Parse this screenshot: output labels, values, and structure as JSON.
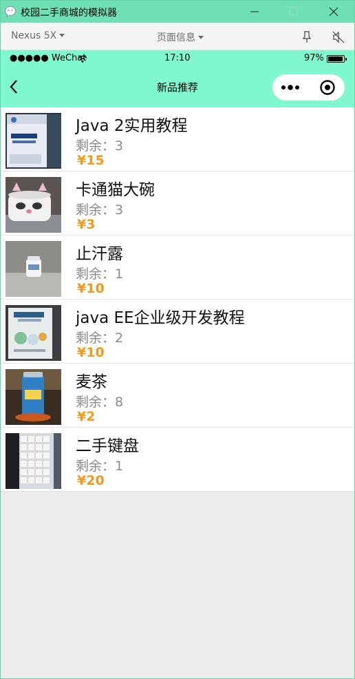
{
  "window": {
    "title": "校园二手商城的模拟器"
  },
  "toolbar": {
    "device": "Nexus 5X",
    "page_info": "页面信息"
  },
  "status_bar": {
    "carrier": "●●●●● WeChat",
    "time": "17:10",
    "battery": "97%",
    "battery_level": 0.97
  },
  "nav": {
    "title": "新品推荐"
  },
  "stock_prefix": "剩余：",
  "currency": "¥",
  "products": [
    {
      "name": "Java 2实用教程",
      "stock": "剩余：3",
      "price": "¥15",
      "image": "book-cover-java2"
    },
    {
      "name": "卡通猫大碗",
      "stock": "剩余：3",
      "price": "¥3",
      "image": "cat-bowl"
    },
    {
      "name": "止汗露",
      "stock": "剩余：1",
      "price": "¥10",
      "image": "antiperspirant-bottle"
    },
    {
      "name": "java EE企业级开发教程",
      "stock": "剩余：2",
      "price": "¥10",
      "image": "book-cover-javaee"
    },
    {
      "name": "麦茶",
      "stock": "剩余：8",
      "price": "¥2",
      "image": "barley-tea-can"
    },
    {
      "name": "二手键盘",
      "stock": "剩余：1",
      "price": "¥20",
      "image": "keyboard"
    }
  ],
  "colors": {
    "titlebar": "#6fe0b3",
    "navbar": "#7ff7cf",
    "price": "#f39a1e",
    "background": "#ececec"
  }
}
